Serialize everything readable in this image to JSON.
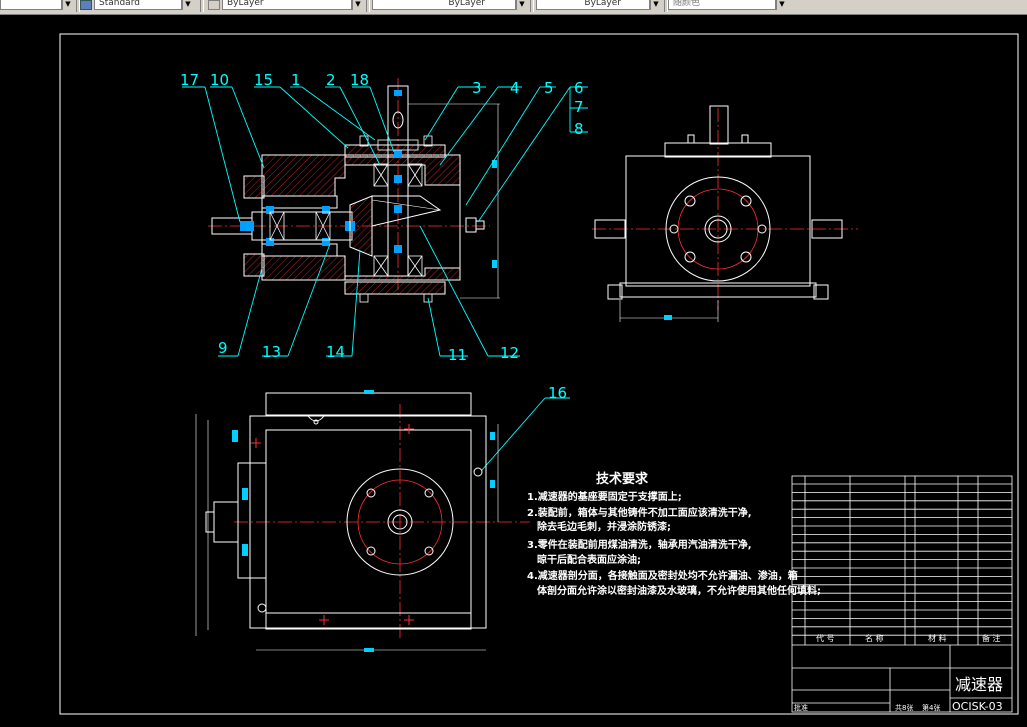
{
  "toolbar": {
    "text_style": "Standard",
    "layer": "ByLayer",
    "linetype": "ByLayer",
    "lineweight": "ByLayer",
    "plot_style": "随颜色"
  },
  "drawing": {
    "part_labels": {
      "p17": "17",
      "p10": "10",
      "p15": "15",
      "p1": "1",
      "p2": "2",
      "p18": "18",
      "p3": "3",
      "p4": "4",
      "p5": "5",
      "p6": "6",
      "p7": "7",
      "p8": "8",
      "p9": "9",
      "p13": "13",
      "p14": "14",
      "p11": "11",
      "p12": "12",
      "p16": "16"
    },
    "tech_req": {
      "title": "技术要求",
      "lines": [
        "1.减速器的基座要固定于支撑面上;",
        "2.装配前，箱体与其他铸件不加工面应该清洗干净,",
        "除去毛边毛刺，并浸涂防锈漆;",
        "3.零件在装配前用煤油清洗，轴承用汽油清洗干净,",
        "晾干后配合表面应涂油;",
        "4.减速器剖分面，各接触面及密封处均不允许漏油、渗油，箱",
        "体剖分面允许涂以密封油漆及水玻璃，不允许使用其他任何填料;"
      ]
    },
    "title_block": {
      "name": "减速器",
      "code": "OCISK-03",
      "col_code": "代 号",
      "col_name": "名 称",
      "col_material": "材 料",
      "col_note": "备 注",
      "sheet_total": "共8张",
      "sheet_no": "第4张",
      "approve": "批准"
    }
  }
}
